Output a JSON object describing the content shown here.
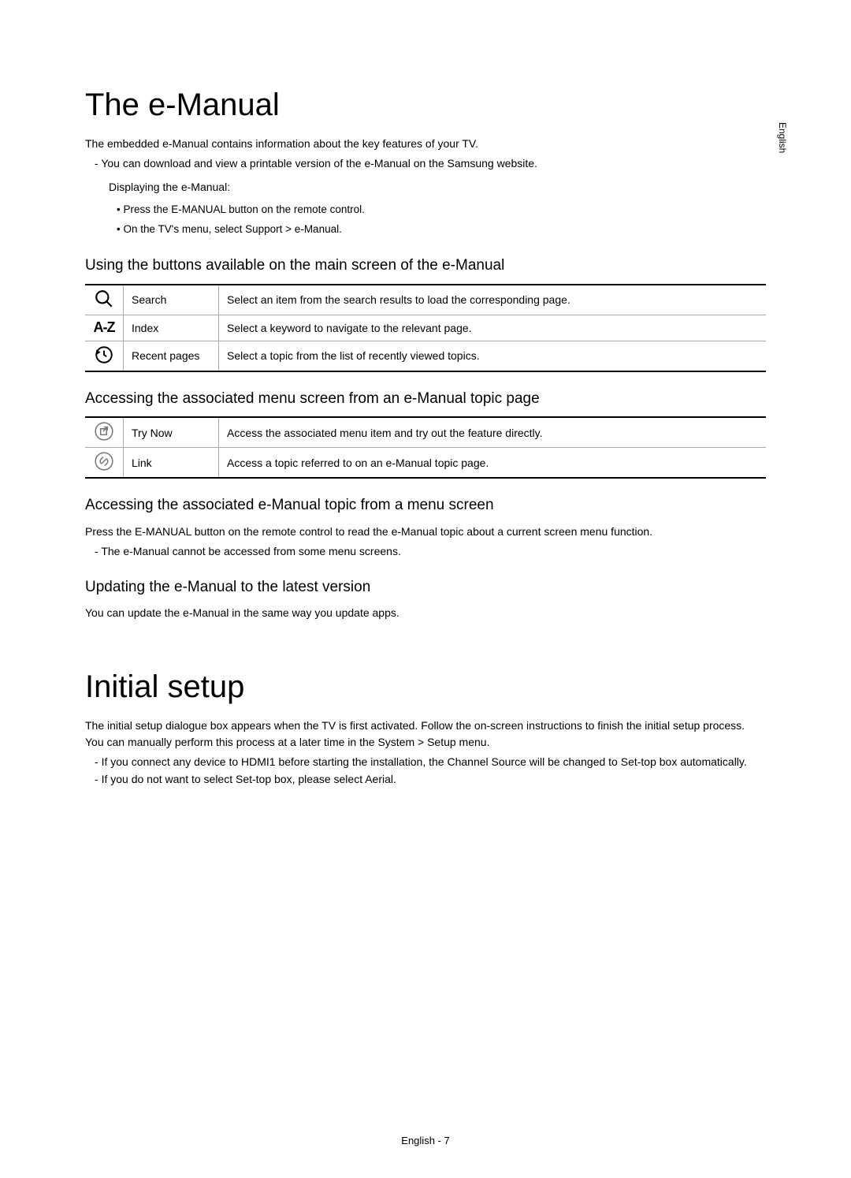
{
  "side_label": "English",
  "section1": {
    "title": "The e-Manual",
    "intro": "The embedded e-Manual contains information about the key features of your TV.",
    "dash1": "You can download and view a printable version of the e-Manual on the Samsung website.",
    "sub1": "Displaying the e-Manual:",
    "bullets": {
      "b1_pre": "Press the ",
      "b1_bold": "E-MANUAL",
      "b1_post": " button on the remote control.",
      "b2_pre": "On the TV's menu, select ",
      "b2_path": "Support > e-Manual",
      "b2_post": "."
    },
    "h2a": "Using the buttons available on the main screen of the e-Manual",
    "table1": [
      {
        "name": "Search",
        "desc": "Select an item from the search results to load the corresponding page."
      },
      {
        "name": "Index",
        "desc": "Select a keyword to navigate to the relevant page."
      },
      {
        "name": "Recent pages",
        "desc": "Select a topic from the list of recently viewed topics."
      }
    ],
    "h2b": "Accessing the associated menu screen from an e-Manual topic page",
    "table2": [
      {
        "name": "Try Now",
        "desc": "Access the associated menu item and try out the feature directly."
      },
      {
        "name": "Link",
        "desc": "Access a topic referred to on an e-Manual topic page."
      }
    ],
    "h2c": "Accessing the associated e-Manual topic from a menu screen",
    "p_c_pre": "Press the ",
    "p_c_bold": "E-MANUAL",
    "p_c_post": " button on the remote control to read the e-Manual topic about a current screen menu function.",
    "dash_c": "The e-Manual cannot be accessed from some menu screens.",
    "h2d": "Updating the e-Manual to the latest version",
    "p_d": "You can update the e-Manual in the same way you update apps."
  },
  "section2": {
    "title": "Initial setup",
    "p1_pre": "The initial setup dialogue box appears when the TV is first activated. Follow the on-screen instructions to finish the initial setup process. You can manually perform this process at a later time in the ",
    "p1_path": "System > Setup",
    "p1_post": " menu.",
    "dash1": "If you connect any device to HDMI1 before starting the installation, the Channel Source will be changed to Set-top box automatically.",
    "dash2_pre": "If you do not want to select Set-top box, please select ",
    "dash2_bold": "Aerial",
    "dash2_post": "."
  },
  "footer": "English - 7"
}
